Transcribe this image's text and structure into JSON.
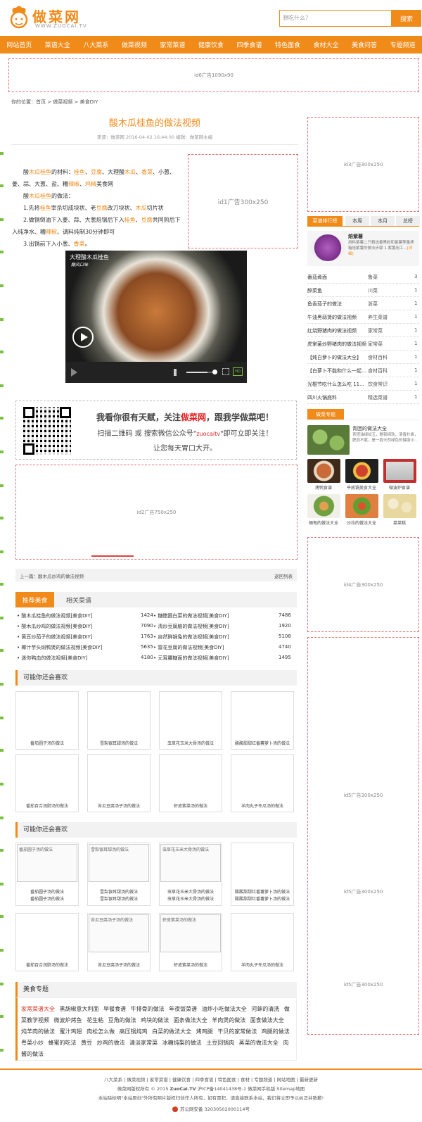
{
  "header": {
    "logo_text": "做菜网",
    "logo_sub": "WWW.ZUOCAI.TV",
    "search_placeholder": "想吃什么？",
    "search_button": "搜索"
  },
  "nav": [
    "网站首页",
    "菜谱大全",
    "八大菜系",
    "做菜视频",
    "家常菜谱",
    "健康饮食",
    "四季食谱",
    "特色面食",
    "食材大全",
    "美食问答",
    "专题频道"
  ],
  "ads": {
    "ad6": "id6广告1090x90",
    "ad1": "id1广告300x250",
    "ad2": "id2广告750x250",
    "ad3": "id3广告300x250",
    "ad4": "id4广告300x250",
    "ad5a": "id5广告300x250",
    "ad5b": "id5广告300x250",
    "ad5c": "id5广告300x250"
  },
  "breadcrumb": "你的位置：首页 > 做菜视频 > 美食DIY",
  "article": {
    "title": "酸木瓜桂鱼的做法视频",
    "meta": "来源：做菜网    2016-04-02 16:44:00    编辑：做菜网主编",
    "video_title": "大理酸木瓜桂鱼",
    "video_logo": "酷风口味"
  },
  "qr": {
    "line1_a": "我看你很有天赋，关注",
    "line1_b": "做菜网",
    "line1_c": "，跟我学做菜吧！",
    "line2_a": "扫描二维码 或 搜索微信公众号\"",
    "line2_b": "zuocaitv",
    "line2_c": "\"即可立即关注！",
    "line3": "让您每天胃口大开。"
  },
  "prevnext": {
    "prev": "上一篇：酸木瓜炒鸡的做法视频",
    "back": "返回列表"
  },
  "recommend": {
    "tab_active": "推荐美食",
    "tab_other": "相关菜谱",
    "left": [
      {
        "t": "• 酸木瓜桂鱼的做法视频[美食DIY]",
        "n": "1424"
      },
      {
        "t": "• 酸木瓜炒鸡的做法视频[美食DIY]",
        "n": "7090"
      },
      {
        "t": "• 黄豆炒茄子的做法视频[美食DIY]",
        "n": "1763"
      },
      {
        "t": "• 椰汁芋头焖鸭煲的做法视频[美食DIY]",
        "n": "5635"
      },
      {
        "t": "• 迷你鸭血的做法视频[美食DIY]",
        "n": "4180"
      }
    ],
    "right": [
      {
        "t": "• 糖醋圆白菜的做法视频[美食DIY]",
        "n": "7486"
      },
      {
        "t": "• 清炒豆腐脑的做法视频[美食DIY]",
        "n": "1920"
      },
      {
        "t": "• 自然鲜锅兔的做法视频[美食DIY]",
        "n": "5108"
      },
      {
        "t": "• 雷花豆腐的做法视频[美食DIY]",
        "n": "4740"
      },
      {
        "t": "• 元宵腰糖面的做法视频[美食DIY]",
        "n": "1495"
      }
    ]
  },
  "like1": {
    "title": "可能你还会喜欢",
    "items": [
      "番茄圆子汤的做法",
      "雪梨银耳甜汤的做法",
      "虫草花玉米大骨汤的做法",
      "酸酸甜甜红番薯萝卜汤的做法",
      "番茄百合润肺汤的做法",
      "苦瓜豆腐汤子汤的做法",
      "虾皮紫菜汤的做法",
      "羊肉丸子冬瓜汤的做法"
    ]
  },
  "like2": {
    "title": "可能你还会喜欢",
    "items": [
      "番茄圆子汤的做法",
      "雪梨银耳甜汤的做法",
      "虫草花玉米大骨汤的做法",
      "酸酸甜甜红番薯萝卜汤的做法",
      "番茄百合润肺汤的做法",
      "苦瓜豆腐汤子汤的做法",
      "虾皮紫菜汤的做法",
      "羊肉丸子冬瓜汤的做法"
    ]
  },
  "topics": {
    "title": "美食专题",
    "first": "家常菜谱大全",
    "text": "黑胡椒意大利面  早餐食谱  牛排骨的做法  年夜饭菜谱  油炸小吃做法大全  河蚌的清洗  做菜教学视频  微波炉烤鱼  花生粘  豆角的做法  鸡块的做法  面条做法大全  羊肉煲的做法  面食做法大全  炖羊肉的做法  蜜汁鸡翅  肉松怎么做  高压锅炖鸡  白菜的做法大全  烤鸡腿  干贝的家常做法  鸡腿的做法  粤菜小炒  蜂蜜的吃法  黄豆  炒鸡的做法  清淡家常菜  冰糖炖梨的做法  土豆回锅肉  蒸菜的做法大全  肉酱的做法"
  },
  "ranking": {
    "tab_active": "菜谱排行榜",
    "tabs": [
      "本周",
      "本月",
      "总榜"
    ],
    "feature_title": "焙紫薯",
    "feature_desc": "用料紫薯二只精选量黑粉和紫薯等量烤箱焙紫薯的做法步骤 1.紫薯用工...",
    "feature_more": "[详细]",
    "rows": [
      {
        "name": "番茄煮面",
        "cat": "鲁菜",
        "n": "3"
      },
      {
        "name": "醉菜鱼",
        "cat": "川菜",
        "n": "1"
      },
      {
        "name": "鱼香茄子的做法",
        "cat": "浙菜",
        "n": "1"
      },
      {
        "name": "牛油黑蒜煲的做法视频",
        "cat": "养生菜谱",
        "n": "1"
      },
      {
        "name": "红烧野猪肉的做法视频",
        "cat": "家常菜",
        "n": "1"
      },
      {
        "name": "虎掌菌炒野猪肉的做法视频",
        "cat": "家常菜",
        "n": "1"
      },
      {
        "name": "【炖白萝卜的做法大全】",
        "cat": "食材百科",
        "n": "1"
      },
      {
        "name": "【白萝卜不能和什么一起...",
        "cat": "食材百科",
        "n": "1"
      },
      {
        "name": "光棍节吃什么怎么吃 11...",
        "cat": "饮食常识",
        "n": "1"
      },
      {
        "name": "四川火锅底料",
        "cat": "精选菜谱",
        "n": "1"
      }
    ]
  },
  "topic_side": {
    "button": "做菜专题",
    "first_title": "青团的做法大全",
    "first_desc": "青团油绿如玉，糯韧绵软，清香扑鼻，肥而不腻，是一款天然绿色的健康小...",
    "items": [
      "烤鸭食谱",
      "平底锅美食大全",
      "微波炉食谱",
      "缅甸的做法大全",
      "沙拉的做法大全",
      "菜菜糕"
    ]
  },
  "footer": {
    "links": "八大菜系 | 做菜视频 | 家常菜谱 | 健康饮食 | 四季食谱 | 特色面食 | 食材 | 专题频道 | 网站地图 | 最新更新",
    "copy_a": "做菜网版权所有 © 2015 ",
    "copy_b": "ZuoCai.TV",
    "copy_c": " 沪ICP备14041438号-1   做菜网手机版   Sitemap地图",
    "notice": "本站除标明\"本站原创\"外所有照片版权归创作人所有，如有冒犯，请直接联系本站，我们将立即予以纠正并致歉!",
    "police": "苏公网安备 32030502000114号"
  },
  "colors": {
    "accent": "#f08a18",
    "ad_border": "#e07070"
  }
}
